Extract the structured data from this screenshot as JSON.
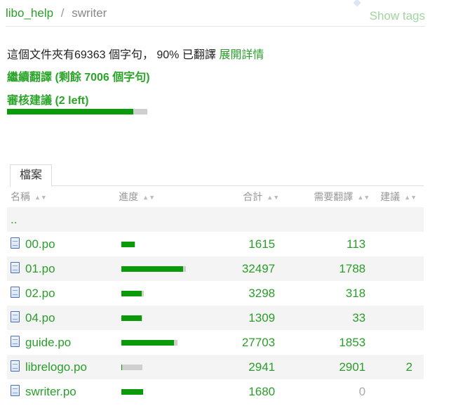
{
  "breadcrumb": {
    "project": "libo_help",
    "separator": "/",
    "component": "swriter"
  },
  "header": {
    "show_tags": "Show tags"
  },
  "summary": {
    "text": "這個文件夾有69363 個字句， 90% 已翻譯",
    "details_link": "展開詳情",
    "continue_label": "繼續翻譯 (剩餘 7006 個字句)",
    "review_label": "審核建議 (2 left)",
    "progress_fraction": 0.9
  },
  "tabs": [
    {
      "label": "檔案"
    }
  ],
  "table": {
    "columns": {
      "name": "名稱",
      "progress": "進度",
      "total": "合計",
      "need": "需要翻譯",
      "suggestions": "建議"
    },
    "parent_dir": "..",
    "rows": [
      {
        "name": "00.po",
        "progress": 0.93,
        "bar_scale": 0.2,
        "total": "1615",
        "need": "113",
        "suggestions": ""
      },
      {
        "name": "01.po",
        "progress": 0.95,
        "bar_scale": 0.92,
        "total": "32497",
        "need": "1788",
        "suggestions": ""
      },
      {
        "name": "02.po",
        "progress": 0.9,
        "bar_scale": 0.32,
        "total": "3298",
        "need": "318",
        "suggestions": ""
      },
      {
        "name": "04.po",
        "progress": 0.97,
        "bar_scale": 0.3,
        "total": "1309",
        "need": "33",
        "suggestions": ""
      },
      {
        "name": "guide.po",
        "progress": 0.93,
        "bar_scale": 0.8,
        "total": "27703",
        "need": "1853",
        "suggestions": ""
      },
      {
        "name": "librelogo.po",
        "progress": 0.01,
        "bar_scale": 0.3,
        "total": "2941",
        "need": "2901",
        "suggestions": "2"
      },
      {
        "name": "swriter.po",
        "progress": 1.0,
        "bar_scale": 0.31,
        "total": "1680",
        "need": "0",
        "suggestions": ""
      }
    ]
  },
  "icons": {
    "file": "file-icon",
    "sort": "sort-arrows-icon"
  },
  "colors": {
    "accent": "#2a9d2a",
    "bar_fill": "#0a9a0a",
    "bar_empty": "#cfcfcf",
    "row_stripe": "#f4f4f4"
  }
}
